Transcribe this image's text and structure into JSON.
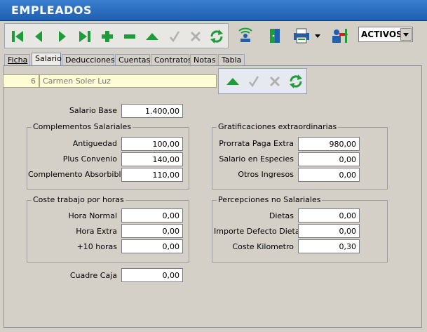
{
  "window": {
    "title": "EMPLEADOS"
  },
  "toolbar": {
    "filter_value": "ACTIVOS"
  },
  "tabs": [
    {
      "label": "Ficha",
      "underline": "F"
    },
    {
      "label": "Salario"
    },
    {
      "label": "Deducciones"
    },
    {
      "label": "Cuentas"
    },
    {
      "label": "Contratos"
    },
    {
      "label": "Notas"
    },
    {
      "label": "Tabla"
    }
  ],
  "record": {
    "id": "6",
    "name": "Carmen Soler Luz"
  },
  "form": {
    "salario_base": {
      "label": "Salario Base",
      "value": "1.400,00"
    },
    "complementos": {
      "title": "Complementos Salariales",
      "antiguedad": {
        "label": "Antiguedad",
        "value": "100,00"
      },
      "plus_convenio": {
        "label": "Plus Convenio",
        "value": "140,00"
      },
      "complemento_absorbible": {
        "label": "Complemento Absorbible",
        "value": "110,00"
      }
    },
    "gratificaciones": {
      "title": "Gratificaciones extraordinarias",
      "prorrata": {
        "label": "Prorrata Paga Extra",
        "value": "980,00"
      },
      "salario_especies": {
        "label": "Salario en Especies",
        "value": "0,00"
      },
      "otros_ingresos": {
        "label": "Otros Ingresos",
        "value": "0,00"
      }
    },
    "coste_horas": {
      "title": "Coste trabajo por horas",
      "hora_normal": {
        "label": "Hora Normal",
        "value": "0,00"
      },
      "hora_extra": {
        "label": "Hora Extra",
        "value": "0,00"
      },
      "mas_10_horas": {
        "label": "+10 horas",
        "value": "0,00"
      }
    },
    "percepciones": {
      "title": "Percepciones no Salariales",
      "dietas": {
        "label": "Dietas",
        "value": "0,00"
      },
      "importe_defecto_dietas": {
        "label": "Importe Defecto Dietas",
        "value": "0,00"
      },
      "coste_kilometro": {
        "label": "Coste Kilometro",
        "value": "0,30"
      }
    },
    "cuadre_caja": {
      "label": "Cuadre Caja",
      "value": "0,00"
    }
  },
  "colors": {
    "title_bg": "#2a6fc4",
    "nav_green": "#1e9c3a",
    "disabled_gray": "#b0b0b0"
  }
}
